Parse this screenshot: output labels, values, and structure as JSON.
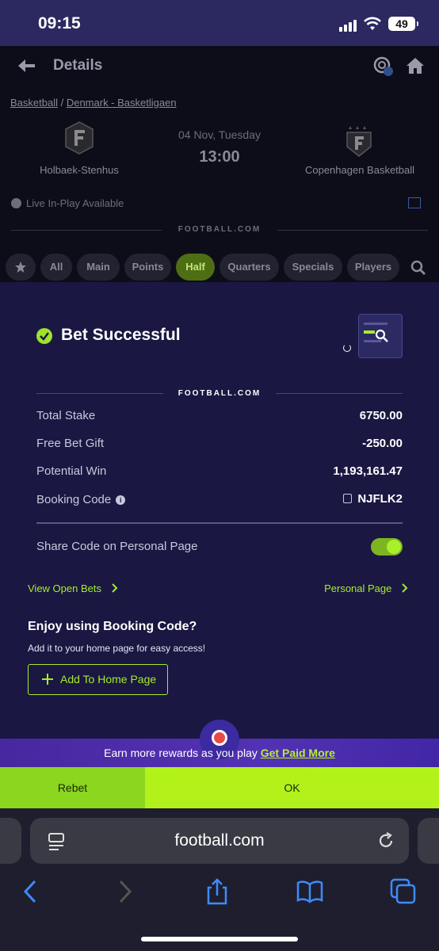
{
  "status": {
    "time": "09:15",
    "battery": "49"
  },
  "header": {
    "title": "Details"
  },
  "breadcrumb": {
    "sport": "Basketball",
    "separator": " / ",
    "league": "Denmark - Basketligaen"
  },
  "match": {
    "home": "Holbaek-Stenhus",
    "away": "Copenhagen Basketball",
    "date": "04 Nov, Tuesday",
    "time": "13:00",
    "live": "Live In-Play Available",
    "brand": "FOOTBALL.COM"
  },
  "tabs": [
    {
      "label": "All"
    },
    {
      "label": "Main"
    },
    {
      "label": "Points"
    },
    {
      "label": "Half",
      "active": true
    },
    {
      "label": "Quarters"
    },
    {
      "label": "Specials"
    },
    {
      "label": "Players"
    }
  ],
  "bet": {
    "title": "Bet Successful",
    "brand": "FOOTBALL.COM",
    "rows": [
      {
        "label": "Total Stake",
        "value": "6750.00"
      },
      {
        "label": "Free Bet Gift",
        "value": "-250.00"
      },
      {
        "label": "Potential Win",
        "value": "1,193,161.47"
      },
      {
        "label": "Booking Code",
        "value": "NJFLK2"
      }
    ],
    "share_label": "Share Code on Personal Page",
    "share_enabled": true,
    "view_open_bets": "View Open Bets",
    "personal_page": "Personal Page"
  },
  "promo": {
    "title": "Enjoy using Booking Code?",
    "subtitle": "Add it to your home page for easy access!",
    "button": "Add To Home Page"
  },
  "rewards": {
    "text": "Earn more rewards as you play ",
    "link": "Get Paid More"
  },
  "actions": {
    "rebet": "Rebet",
    "ok": "OK"
  },
  "browser": {
    "url": "football.com"
  },
  "colors": {
    "accent": "#a6ec2c",
    "sheet_bg": "#1a1742",
    "ok_bg": "#b2f21a"
  }
}
